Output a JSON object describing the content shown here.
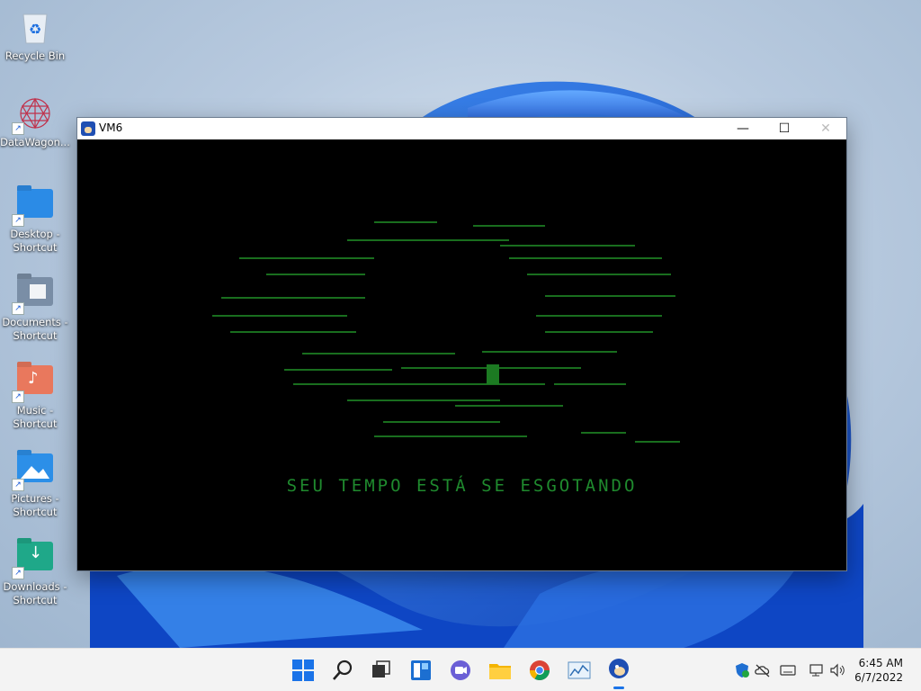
{
  "desktop": {
    "icons": [
      {
        "label": "Recycle Bin"
      },
      {
        "label": "DataWagon..."
      },
      {
        "label": "Desktop - Shortcut"
      },
      {
        "label": "Documents - Shortcut"
      },
      {
        "label": "Music - Shortcut"
      },
      {
        "label": "Pictures - Shortcut"
      },
      {
        "label": "Downloads - Shortcut"
      }
    ]
  },
  "window": {
    "title": "VM6",
    "icon": "sonic-app-icon",
    "buttons": {
      "minimize": "—",
      "maximize": "☐",
      "close": "✕"
    },
    "game_text": "SEU TEMPO ESTÁ SE ESGOTANDO",
    "text_color": "#1f8a2e"
  },
  "taskbar": {
    "items": [
      "start-icon",
      "search-icon",
      "task-view-icon",
      "widgets-icon",
      "chat-icon",
      "file-explorer-icon",
      "chrome-icon",
      "performance-monitor-icon",
      "vm6-app-icon"
    ],
    "tray": [
      "security-icon",
      "onedrive-icon",
      "keyboard-icon",
      "network-icon",
      "volume-icon"
    ],
    "time": "6:45 AM",
    "date": "6/7/2022"
  }
}
